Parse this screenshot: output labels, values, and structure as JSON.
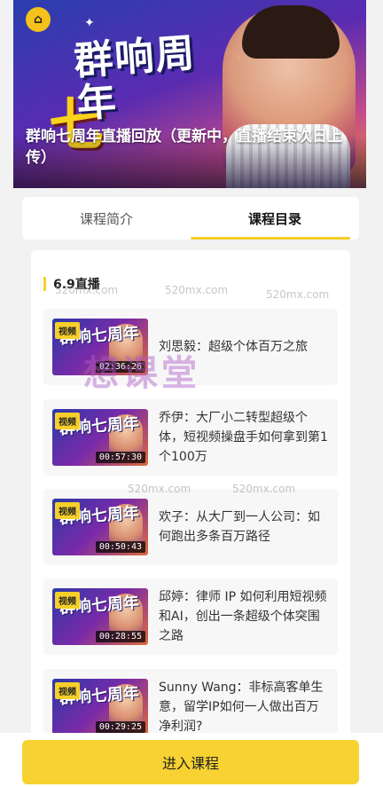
{
  "banner": {
    "title": "群响七周年直播回放（更新中，直播结束次日上传）",
    "artwork_title": "群响周年",
    "artwork_number": "七"
  },
  "tabs": [
    {
      "label": "课程简介",
      "active": false
    },
    {
      "label": "课程目录",
      "active": true
    }
  ],
  "section": {
    "title": "6.9直播"
  },
  "lessons": [
    {
      "tag": "视频",
      "duration": "02:36:26",
      "title": "刘思毅：超级个体百万之旅"
    },
    {
      "tag": "视频",
      "duration": "00:57:30",
      "title": "乔伊：大厂小二转型超级个体，短视频操盘手如何拿到第1个100万"
    },
    {
      "tag": "视频",
      "duration": "00:50:43",
      "title": "欢子：从大厂到一人公司：如何跑出多条百万路径"
    },
    {
      "tag": "视频",
      "duration": "00:28:55",
      "title": "邱婷：律师 IP 如何利用短视频和AI，创出一条超级个体突围之路"
    },
    {
      "tag": "视频",
      "duration": "00:29:25",
      "title": "Sunny Wang：非标高客单生意，留学IP如何一人做出百万净利润?"
    }
  ],
  "thumbnail_text": "群响七周年",
  "watermark": {
    "main": "想课堂",
    "small": "520mx.com"
  },
  "cta": {
    "label": "进入课程"
  },
  "colors": {
    "accent": "#f7d232",
    "active_tab_underline": "#f5cf2a"
  }
}
